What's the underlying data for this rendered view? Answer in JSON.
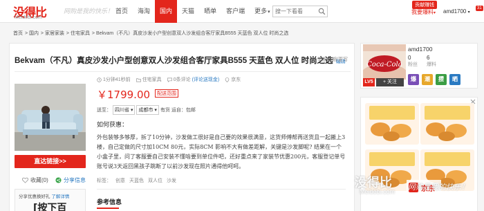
{
  "header": {
    "logo_main": "没得比",
    "logo_sub": "Meidebi.com",
    "slogan": "网购是我的快乐！",
    "nav": [
      {
        "label": "首页",
        "active": false
      },
      {
        "label": "海淘",
        "active": false
      },
      {
        "label": "国内",
        "active": true
      },
      {
        "label": "天猫",
        "active": false
      },
      {
        "label": "晒单",
        "active": false
      },
      {
        "label": "客户端",
        "active": false
      },
      {
        "label": "更多",
        "active": false
      }
    ],
    "search_placeholder": "搜一下看看",
    "tip_badge": "贡献赚钱",
    "baoliao": "我要爆料",
    "username": "amd1700",
    "msg_count": "31"
  },
  "breadcrumb": [
    "首页",
    "国内",
    "家居家装",
    "住宅家具",
    "Bekvam（不凡）真皮沙发小户型创意双人沙发组合客厅家具B555 天蓝色 双人位 时尚之选"
  ],
  "product": {
    "title": "Bekvam（不凡）真皮沙发小户型创意双人沙发组合客厅家具B555 天蓝色 双人位 时尚之选",
    "edit_label": "编辑",
    "report_label": "举报过期/更写",
    "meta": {
      "time": "1分钟41秒前",
      "category": "住宅家具",
      "comments": "0条评论",
      "comment_link": "(评论送现金)",
      "store": "京东"
    },
    "price": "￥1799.00",
    "ship_badge": "配送范围",
    "delivery_label": "送至：",
    "province": "四川省",
    "city": "成都市",
    "stock_label": "有货",
    "ship_from": "运自：包邮",
    "content_heading": "如何获惠：",
    "content_body": "外包装够多够厚，拆了10分钟，沙发做工很好是自己要的效果很满意，这货师傅帮再送货且一起搬上3楼，自己定做的尺寸加10CM 80元，实际8CM 影响不大有做差距解，关键是沙发脚呢? 结果在一个小盒子里，问了客服要自己安装不懂啥要到单位件吧，还好重点来了家装节优惠200元，客服登记单号账号说3天返回黑孩子跳断了以前沙发现在照片通得他呵呵。",
    "tags": [
      "标签：",
      "创意",
      "天蓝色",
      "双人位",
      "沙发"
    ],
    "ref_title": "参考信息",
    "buy_button": "直达链接>>",
    "collect_label": "收藏(0)",
    "share_label": "分享信息",
    "coupon_text": "分享优惠换好礼",
    "coupon_link": "了解详情",
    "coupon_big": "[按下百"
  },
  "profile": {
    "name": "amd1700",
    "stats": [
      {
        "value": "0",
        "label": "粉丝"
      },
      {
        "value": "6",
        "label": "爆料"
      }
    ],
    "level": "LV5",
    "follow": "+ 关注",
    "medals": [
      {
        "char": "爆",
        "color": "#7a4fb6"
      },
      {
        "char": "潮",
        "color": "#e7a72a"
      },
      {
        "char": "攒",
        "color": "#3b9d44"
      },
      {
        "char": "晒",
        "color": "#2a7ac2"
      }
    ]
  },
  "ad": {
    "brand": "JD.COM",
    "jd_label": "京东"
  },
  "watermark": {
    "main": "没得比",
    "sub": "Meidebi.com",
    "slogan": "网购是我的快乐！"
  },
  "colors": {
    "brand_red": "#e3261c",
    "link_blue": "#2a7ac2"
  }
}
